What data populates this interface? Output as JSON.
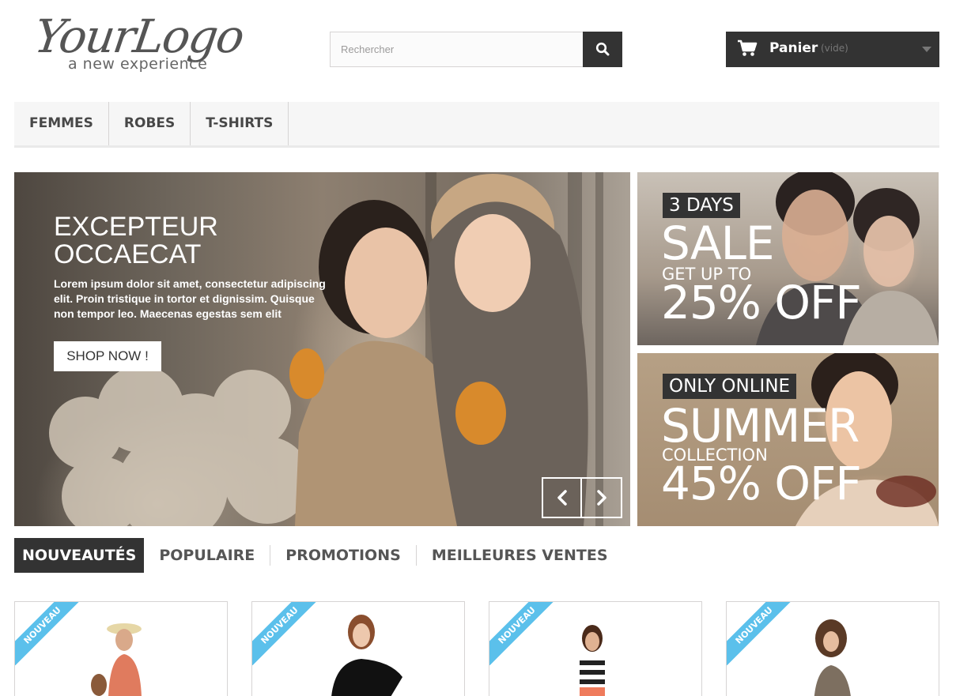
{
  "header": {
    "logo": {
      "main": "YourLogo",
      "tagline": "a new experience"
    },
    "search": {
      "placeholder": "Rechercher",
      "icon": "search-icon"
    },
    "cart": {
      "label": "Panier",
      "status": "(vide)",
      "icon": "cart-icon"
    }
  },
  "menu": {
    "items": [
      {
        "label": "FEMMES"
      },
      {
        "label": "ROBES"
      },
      {
        "label": "T-SHIRTS"
      }
    ]
  },
  "slider": {
    "title_line1": "EXCEPTEUR",
    "title_line2": "OCCAECAT",
    "text": "Lorem ipsum dolor sit amet, consectetur adipiscing elit. Proin tristique in tortor et dignissim. Quisque non tempor leo. Maecenas egestas sem elit",
    "button": "SHOP NOW !",
    "prev_icon": "chevron-left-icon",
    "next_icon": "chevron-right-icon"
  },
  "banners": [
    {
      "tag": "3 DAYS",
      "big": "SALE",
      "mid": "GET UP TO",
      "offer": "25% OFF"
    },
    {
      "tag": "ONLY ONLINE",
      "big": "SUMMER",
      "mid": "COLLECTION",
      "offer": "45% OFF"
    }
  ],
  "tabs": [
    {
      "label": "NOUVEAUTÉS",
      "active": true
    },
    {
      "label": "POPULAIRE",
      "active": false
    },
    {
      "label": "PROMOTIONS",
      "active": false
    },
    {
      "label": "MEILLEURES VENTES",
      "active": false
    }
  ],
  "products": [
    {
      "badge": "NOUVEAU"
    },
    {
      "badge": "NOUVEAU"
    },
    {
      "badge": "NOUVEAU"
    },
    {
      "badge": "NOUVEAU"
    }
  ],
  "colors": {
    "dark": "#333333",
    "ribbon": "#5bc0eb",
    "menu_bg": "#f6f6f6",
    "border": "#d6d4d4"
  }
}
